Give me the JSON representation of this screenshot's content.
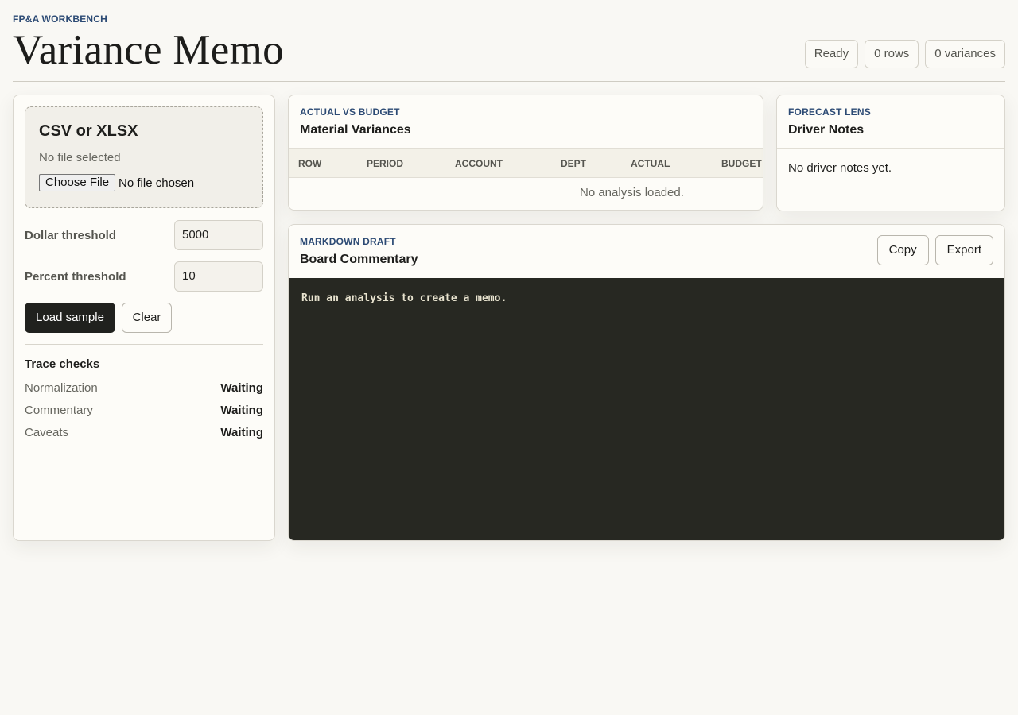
{
  "header": {
    "eyebrow": "FP&A WORKBENCH",
    "title": "Variance Memo",
    "stats": {
      "status": "Ready",
      "rows": "0 rows",
      "variances": "0 variances"
    }
  },
  "upload": {
    "title": "CSV or XLSX",
    "status": "No file selected",
    "file_button": "Choose File",
    "file_text": "No file chosen"
  },
  "thresholds": {
    "dollar_label": "Dollar threshold",
    "dollar_value": "5000",
    "percent_label": "Percent threshold",
    "percent_value": "10"
  },
  "actions": {
    "load_sample": "Load sample",
    "clear": "Clear"
  },
  "trace": {
    "title": "Trace checks",
    "items": [
      {
        "name": "Normalization",
        "state": "Waiting"
      },
      {
        "name": "Commentary",
        "state": "Waiting"
      },
      {
        "name": "Caveats",
        "state": "Waiting"
      }
    ]
  },
  "variances": {
    "eyebrow": "ACTUAL VS BUDGET",
    "title": "Material Variances",
    "columns": [
      "ROW",
      "PERIOD",
      "ACCOUNT",
      "DEPT",
      "ACTUAL",
      "BUDGET"
    ],
    "empty": "No analysis loaded."
  },
  "drivers": {
    "eyebrow": "FORECAST LENS",
    "title": "Driver Notes",
    "empty": "No driver notes yet."
  },
  "memo": {
    "eyebrow": "MARKDOWN DRAFT",
    "title": "Board Commentary",
    "copy": "Copy",
    "export": "Export",
    "body": "Run an analysis to create a memo."
  }
}
